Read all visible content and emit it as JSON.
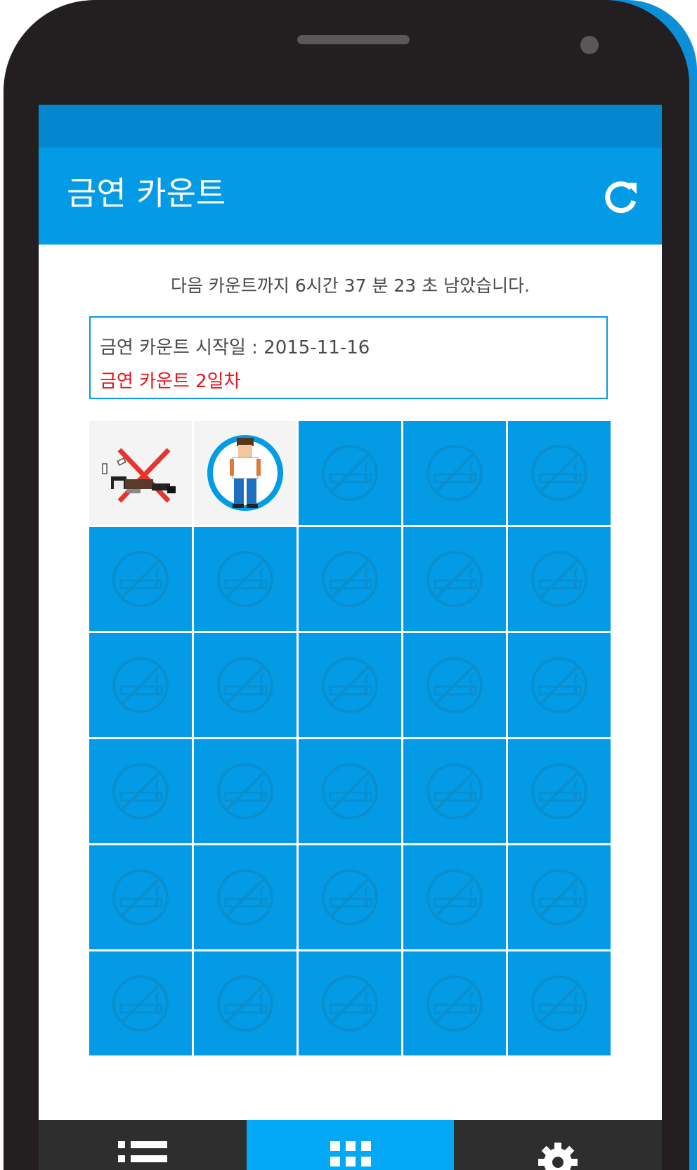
{
  "app": {
    "title": "금연 카운트",
    "accent_color": "#039be5"
  },
  "toolbar": {
    "refresh_icon": "refresh-icon"
  },
  "countdown": {
    "text": "다음 카운트까지 6시간 37 분 23 초 남았습니다."
  },
  "info": {
    "start_date_text": "금연 카운트 시작일 : 2015-11-16",
    "day_count_text": "금연 카운트 2일차",
    "day_count_color": "#e8141b"
  },
  "grid": {
    "total_cells": 30,
    "completed_days": 2,
    "completed_icons": [
      "fallen-smoker-crossed-icon",
      "healthy-man-icon"
    ],
    "pending_icon": "no-smoking-icon"
  },
  "bottom_nav": {
    "tabs": [
      {
        "icon": "list-icon",
        "active": false
      },
      {
        "icon": "grid-icon",
        "active": true
      },
      {
        "icon": "settings-gear-icon",
        "active": false
      }
    ]
  }
}
